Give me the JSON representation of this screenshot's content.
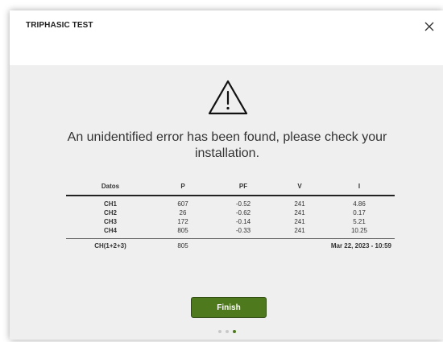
{
  "dialog": {
    "title": "TRIPHASIC TEST",
    "close_icon": "close-icon",
    "warning_icon": "warning-icon",
    "message": "An unidentified error has been found, please check your installation."
  },
  "table": {
    "headers": [
      "Datos",
      "P",
      "PF",
      "V",
      "I"
    ],
    "rows": [
      [
        "CH1",
        "607",
        "-0.52",
        "241",
        "4.86"
      ],
      [
        "CH2",
        "26",
        "-0.62",
        "241",
        "0.17"
      ],
      [
        "CH3",
        "172",
        "-0.14",
        "241",
        "5.21"
      ],
      [
        "CH4",
        "805",
        "-0.33",
        "241",
        "10.25"
      ]
    ],
    "total": {
      "label": "CH(1+2+3)",
      "p": "805",
      "timestamp": "Mar 22, 2023 - 10:59"
    }
  },
  "finish_label": "Finish",
  "pagination": {
    "total": 3,
    "active": 3
  },
  "colors": {
    "accent": "#4e7a1d",
    "body_background": "#efefef",
    "inactive_dot": "#c8c8c8"
  }
}
